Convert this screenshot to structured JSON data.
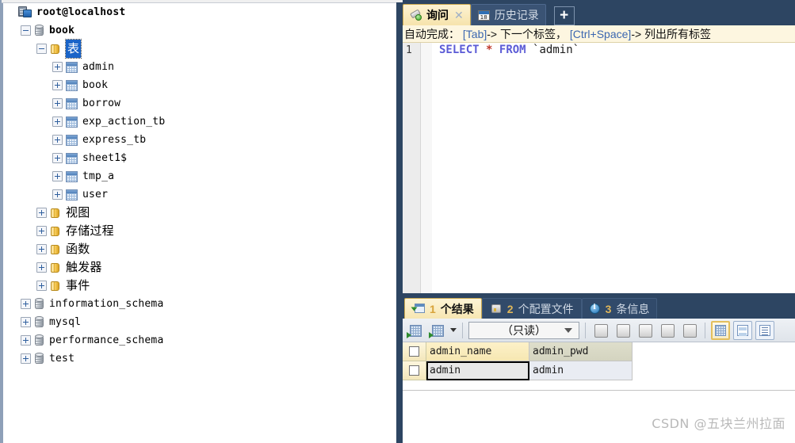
{
  "tree": {
    "root": {
      "label": "root@localhost",
      "icon": "server-icon"
    },
    "items": [
      {
        "label": "book",
        "icon": "database-icon",
        "indent": 1,
        "toggle": "minus",
        "bold": true,
        "cjk": false
      },
      {
        "label": "表",
        "icon": "folder-icon",
        "indent": 2,
        "toggle": "minus",
        "bold": false,
        "cjk": true,
        "selected": true
      },
      {
        "label": "admin",
        "icon": "table-icon",
        "indent": 3,
        "toggle": "plus",
        "bold": false,
        "cjk": false
      },
      {
        "label": "book",
        "icon": "table-icon",
        "indent": 3,
        "toggle": "plus",
        "bold": false,
        "cjk": false
      },
      {
        "label": "borrow",
        "icon": "table-icon",
        "indent": 3,
        "toggle": "plus",
        "bold": false,
        "cjk": false
      },
      {
        "label": "exp_action_tb",
        "icon": "table-icon",
        "indent": 3,
        "toggle": "plus",
        "bold": false,
        "cjk": false
      },
      {
        "label": "express_tb",
        "icon": "table-icon",
        "indent": 3,
        "toggle": "plus",
        "bold": false,
        "cjk": false
      },
      {
        "label": "sheet1$",
        "icon": "table-icon",
        "indent": 3,
        "toggle": "plus",
        "bold": false,
        "cjk": false
      },
      {
        "label": "tmp_a",
        "icon": "table-icon",
        "indent": 3,
        "toggle": "plus",
        "bold": false,
        "cjk": false
      },
      {
        "label": "user",
        "icon": "table-icon",
        "indent": 3,
        "toggle": "plus",
        "bold": false,
        "cjk": false
      },
      {
        "label": "视图",
        "icon": "folder-icon",
        "indent": 2,
        "toggle": "plus",
        "bold": false,
        "cjk": true
      },
      {
        "label": "存储过程",
        "icon": "folder-icon",
        "indent": 2,
        "toggle": "plus",
        "bold": false,
        "cjk": true
      },
      {
        "label": "函数",
        "icon": "folder-icon",
        "indent": 2,
        "toggle": "plus",
        "bold": false,
        "cjk": true
      },
      {
        "label": "触发器",
        "icon": "folder-icon",
        "indent": 2,
        "toggle": "plus",
        "bold": false,
        "cjk": true
      },
      {
        "label": "事件",
        "icon": "folder-icon",
        "indent": 2,
        "toggle": "plus",
        "bold": false,
        "cjk": true
      },
      {
        "label": "information_schema",
        "icon": "database-icon",
        "indent": 1,
        "toggle": "plus",
        "bold": false,
        "cjk": false
      },
      {
        "label": "mysql",
        "icon": "database-icon",
        "indent": 1,
        "toggle": "plus",
        "bold": false,
        "cjk": false
      },
      {
        "label": "performance_schema",
        "icon": "database-icon",
        "indent": 1,
        "toggle": "plus",
        "bold": false,
        "cjk": false
      },
      {
        "label": "test",
        "icon": "database-icon",
        "indent": 1,
        "toggle": "plus",
        "bold": false,
        "cjk": false
      }
    ]
  },
  "editor_tabs": {
    "query": {
      "label": "询问",
      "close": "✕",
      "icon": "query-icon"
    },
    "history": {
      "label": "历史记录",
      "icon": "calendar-icon",
      "day": "18"
    },
    "add": {
      "label": "+"
    }
  },
  "hint": {
    "prefix": "自动完成：",
    "key1": "[Tab]",
    "text1": "-> 下一个标签，",
    "key2": "[Ctrl+Space]",
    "text2": "-> 列出所有标签"
  },
  "editor": {
    "line_number": "1",
    "sql": {
      "select": "SELECT",
      "star": "*",
      "from": "FROM",
      "table": "`admin`"
    }
  },
  "result_tabs": [
    {
      "count": "1",
      "label": "个结果",
      "icon": "result-grid-icon",
      "active": true
    },
    {
      "count": "2",
      "label": "个配置文件",
      "icon": "profile-icon",
      "active": false
    },
    {
      "count": "3",
      "label": "条信息",
      "icon": "info-icon",
      "active": false
    }
  ],
  "result_toolbar": {
    "add_record": "add-record-icon",
    "insert_record": "insert-record-icon",
    "dropdown_caret": "▾",
    "readonly_select": "（只读）",
    "buttons": [
      "add-row-icon",
      "duplicate-row-icon",
      "save-row-icon",
      "delete-row-icon",
      "remove-row-icon"
    ],
    "views": [
      "grid-view-icon",
      "form-view-icon",
      "text-view-icon"
    ],
    "active_view": "grid-view-icon"
  },
  "grid": {
    "columns": [
      "admin_name",
      "admin_pwd"
    ],
    "rows": [
      [
        "admin",
        "admin"
      ]
    ]
  },
  "watermark": "CSDN @五块兰州拉面"
}
